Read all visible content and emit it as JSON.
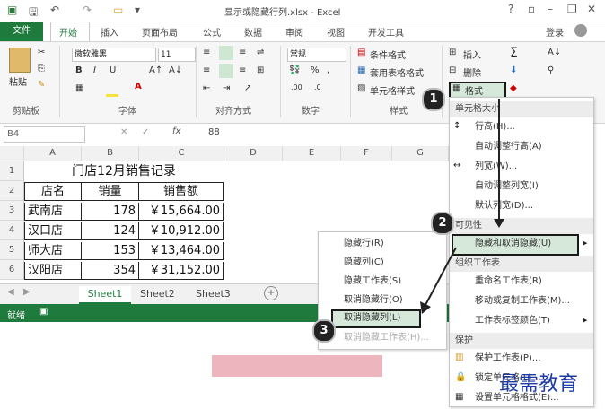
{
  "window": {
    "title": "显示或隐藏行列.xlsx - Excel",
    "help": "?",
    "login": "登录"
  },
  "tabs": [
    "文件",
    "开始",
    "插入",
    "页面布局",
    "公式",
    "数据",
    "审阅",
    "视图",
    "开发工具"
  ],
  "ribbon": {
    "paste": "粘贴",
    "clipboard": "剪贴板",
    "font_name": "微软雅黑",
    "font_size": "11",
    "font_group": "字体",
    "align_group": "对齐方式",
    "number_format": "常规",
    "number_group": "数字",
    "cond_format": "条件格式",
    "table_format": "套用表格格式",
    "cell_style": "单元格样式",
    "style_group": "样式",
    "insert": "插入",
    "delete": "删除",
    "format": "格式"
  },
  "formula_bar": {
    "name_box": "B4",
    "fx": "fx",
    "value": "88"
  },
  "grid": {
    "columns": [
      "A",
      "B",
      "C",
      "D",
      "E",
      "F",
      "G",
      "H"
    ],
    "rows": [
      "1",
      "2",
      "3",
      "4",
      "5",
      "6",
      "7"
    ],
    "title": "门店12月销售记录",
    "headers": [
      "店名",
      "销量",
      "销售额"
    ],
    "data": [
      [
        "武南店",
        "178",
        "￥15,664.00"
      ],
      [
        "汉口店",
        "124",
        "￥10,912.00"
      ],
      [
        "师大店",
        "153",
        "￥13,464.00"
      ],
      [
        "汉阳店",
        "354",
        "￥31,152.00"
      ]
    ]
  },
  "sheets": [
    "Sheet1",
    "Sheet2",
    "Sheet3"
  ],
  "status": "就绪",
  "format_menu": {
    "cell_size_header": "单元格大小",
    "row_height": "行高(H)...",
    "auto_row": "自动调整行高(A)",
    "col_width": "列宽(W)...",
    "auto_col": "自动调整列宽(I)",
    "default_width": "默认列宽(D)...",
    "visibility_header": "可见性",
    "hide_unhide": "隐藏和取消隐藏(U)",
    "organize_header": "组织工作表",
    "rename": "重命名工作表(R)",
    "move_copy": "移动或复制工作表(M)...",
    "tab_color": "工作表标签颜色(T)",
    "protect_header": "保护",
    "protect_sheet": "保护工作表(P)...",
    "lock_cell": "锁定单元格(L)",
    "format_cells": "设置单元格格式(E)..."
  },
  "submenu": {
    "hide_rows": "隐藏行(R)",
    "hide_cols": "隐藏列(C)",
    "hide_sheet": "隐藏工作表(S)",
    "unhide_rows": "取消隐藏行(O)",
    "unhide_cols": "取消隐藏列(L)",
    "unhide_sheet": "取消隐藏工作表(H)..."
  },
  "callouts": [
    "1",
    "2",
    "3"
  ],
  "watermark": "最需教育"
}
